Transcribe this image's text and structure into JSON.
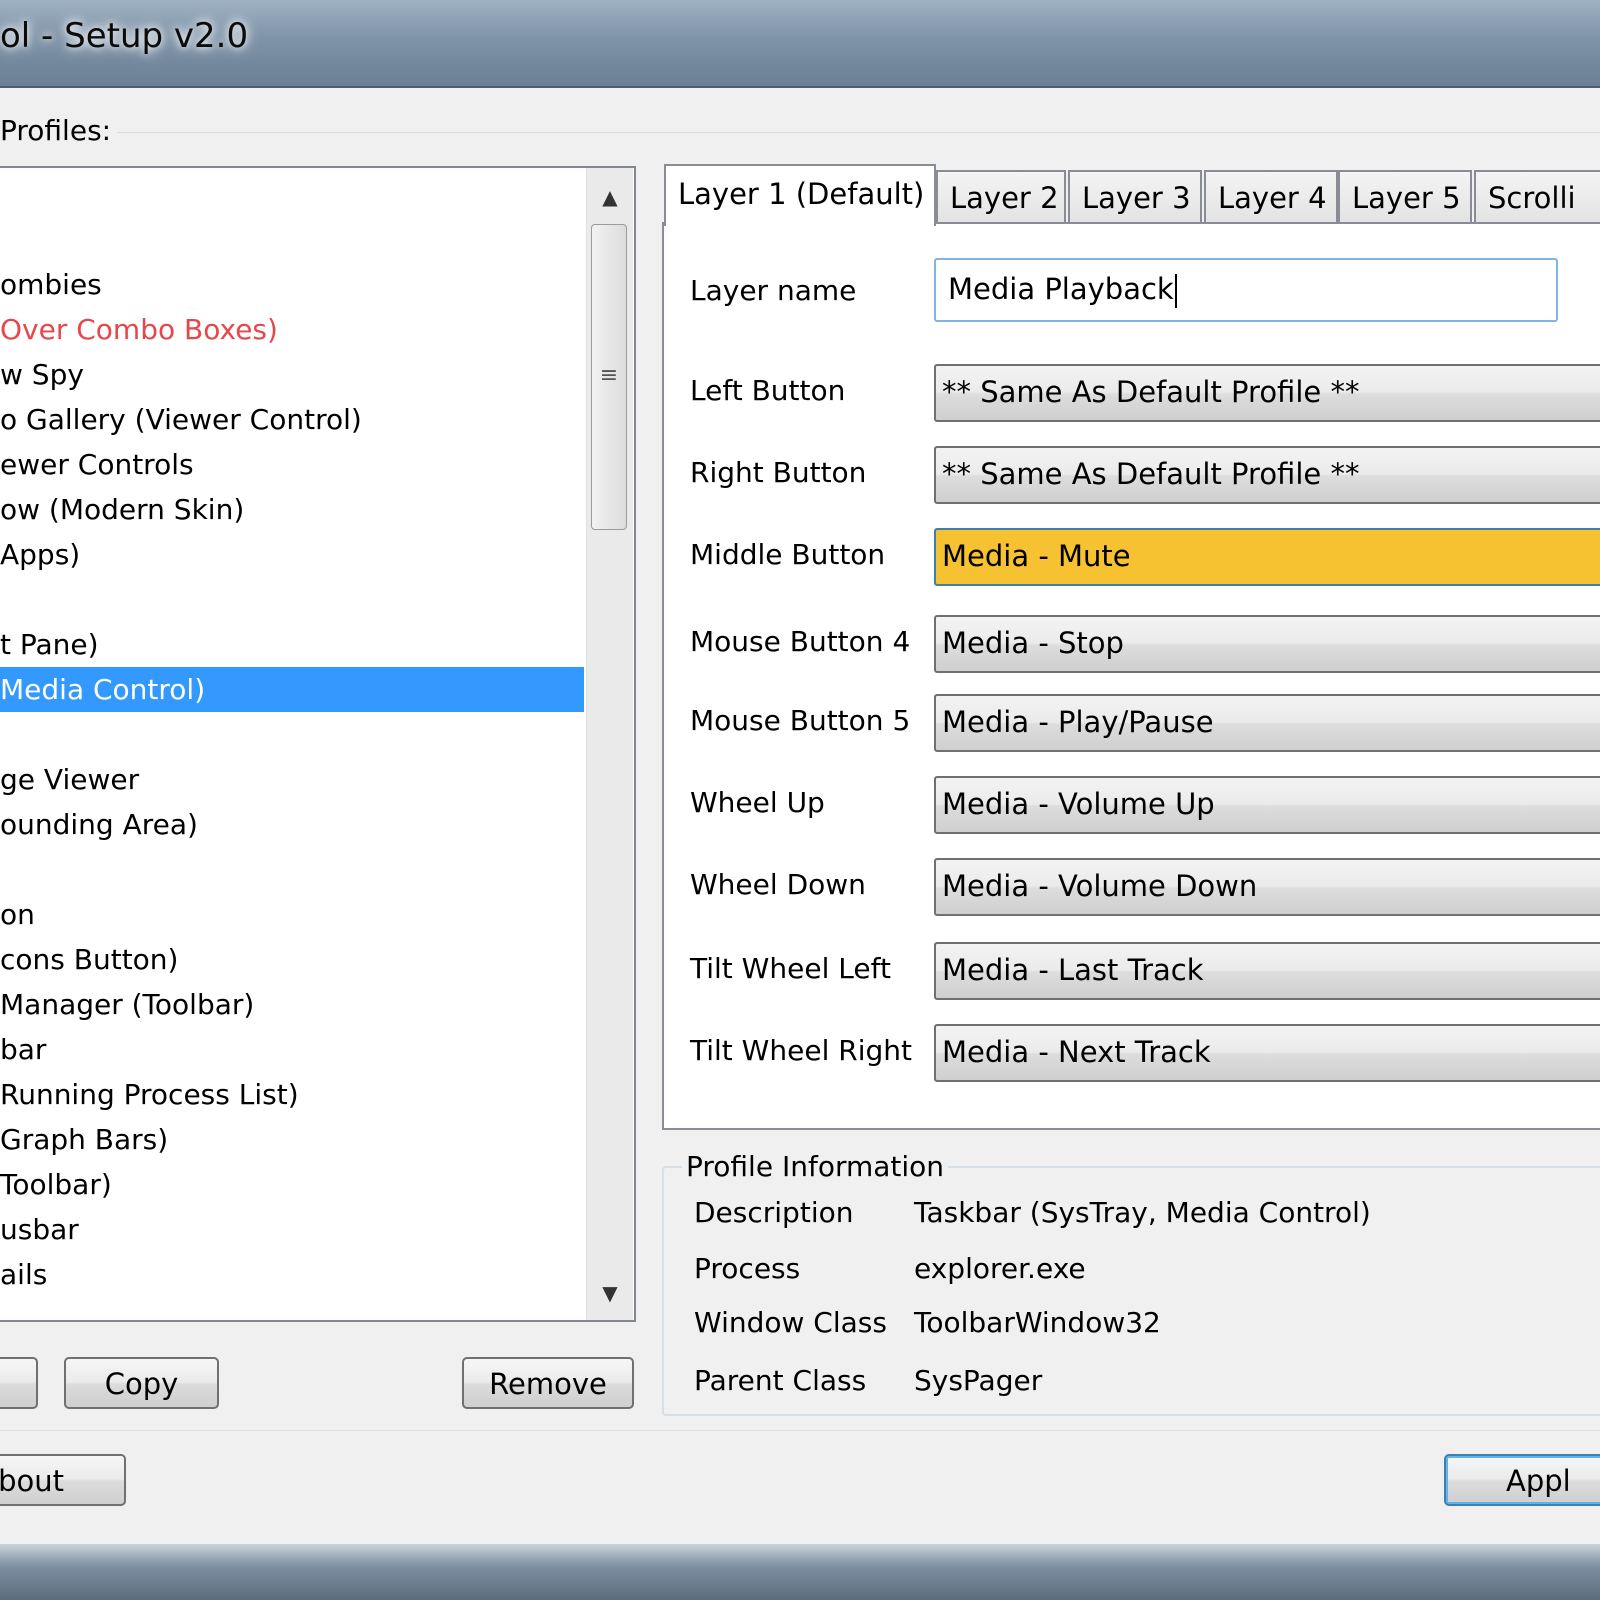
{
  "window": {
    "title": "ol - Setup v2.0"
  },
  "profiles": {
    "label": "Profiles:",
    "items": [
      {
        "text": "ombies",
        "style": "normal"
      },
      {
        "text": " Over Combo Boxes)",
        "style": "red"
      },
      {
        "text": "w Spy",
        "style": "normal"
      },
      {
        "text": "o Gallery (Viewer Control)",
        "style": "normal"
      },
      {
        "text": "ewer Controls",
        "style": "normal"
      },
      {
        "text": "ow (Modern Skin)",
        "style": "normal"
      },
      {
        "text": "Apps)",
        "style": "normal"
      },
      {
        "text": "",
        "style": "normal"
      },
      {
        "text": "t Pane)",
        "style": "normal"
      },
      {
        "text": " Media Control)",
        "style": "selected"
      },
      {
        "text": "",
        "style": "normal"
      },
      {
        "text": "ge Viewer",
        "style": "normal"
      },
      {
        "text": "ounding Area)",
        "style": "normal"
      },
      {
        "text": "",
        "style": "normal"
      },
      {
        "text": "on",
        "style": "normal"
      },
      {
        "text": "cons Button)",
        "style": "normal"
      },
      {
        "text": " Manager (Toolbar)",
        "style": "normal"
      },
      {
        "text": "bar",
        "style": "normal"
      },
      {
        "text": "Running Process List)",
        "style": "normal"
      },
      {
        "text": "Graph Bars)",
        "style": "normal"
      },
      {
        "text": "Toolbar)",
        "style": "normal"
      },
      {
        "text": "usbar",
        "style": "normal"
      },
      {
        "text": "ails",
        "style": "normal"
      }
    ],
    "buttons": {
      "copy": "Copy",
      "remove": "Remove"
    }
  },
  "tabs": [
    {
      "label": "Layer 1 (Default)",
      "active": true
    },
    {
      "label": "Layer 2",
      "active": false
    },
    {
      "label": "Layer 3",
      "active": false
    },
    {
      "label": "Layer 4",
      "active": false
    },
    {
      "label": "Layer 5",
      "active": false
    },
    {
      "label": "Scrolli",
      "active": false
    }
  ],
  "layer": {
    "name_label": "Layer name",
    "name_value": "Media Playback",
    "buttons": [
      {
        "label": "Left Button",
        "value": "** Same As Default Profile **",
        "highlight": false
      },
      {
        "label": "Right Button",
        "value": "** Same As Default Profile **",
        "highlight": false
      },
      {
        "label": "Middle Button",
        "value": "Media - Mute",
        "highlight": true
      },
      {
        "label": "Mouse Button 4",
        "value": "Media - Stop",
        "highlight": false
      },
      {
        "label": "Mouse Button 5",
        "value": "Media - Play/Pause",
        "highlight": false
      },
      {
        "label": "Wheel Up",
        "value": "Media - Volume Up",
        "highlight": false
      },
      {
        "label": "Wheel Down",
        "value": "Media - Volume Down",
        "highlight": false
      },
      {
        "label": "Tilt Wheel Left",
        "value": "Media - Last Track",
        "highlight": false
      },
      {
        "label": "Tilt Wheel Right",
        "value": "Media - Next Track",
        "highlight": false
      }
    ]
  },
  "profile_info": {
    "label": "Profile Information",
    "rows": [
      {
        "label": "Description",
        "value": "Taskbar (SysTray, Media Control)"
      },
      {
        "label": "Process",
        "value": "explorer.exe"
      },
      {
        "label": "Window Class",
        "value": "ToolbarWindow32"
      },
      {
        "label": "Parent Class",
        "value": "SysPager"
      }
    ]
  },
  "footer": {
    "about": "bout",
    "apply": "Appl"
  },
  "colors": {
    "selection": "#3399ff",
    "highlight_combo": "#f7c232",
    "red_item": "#e8474a"
  }
}
